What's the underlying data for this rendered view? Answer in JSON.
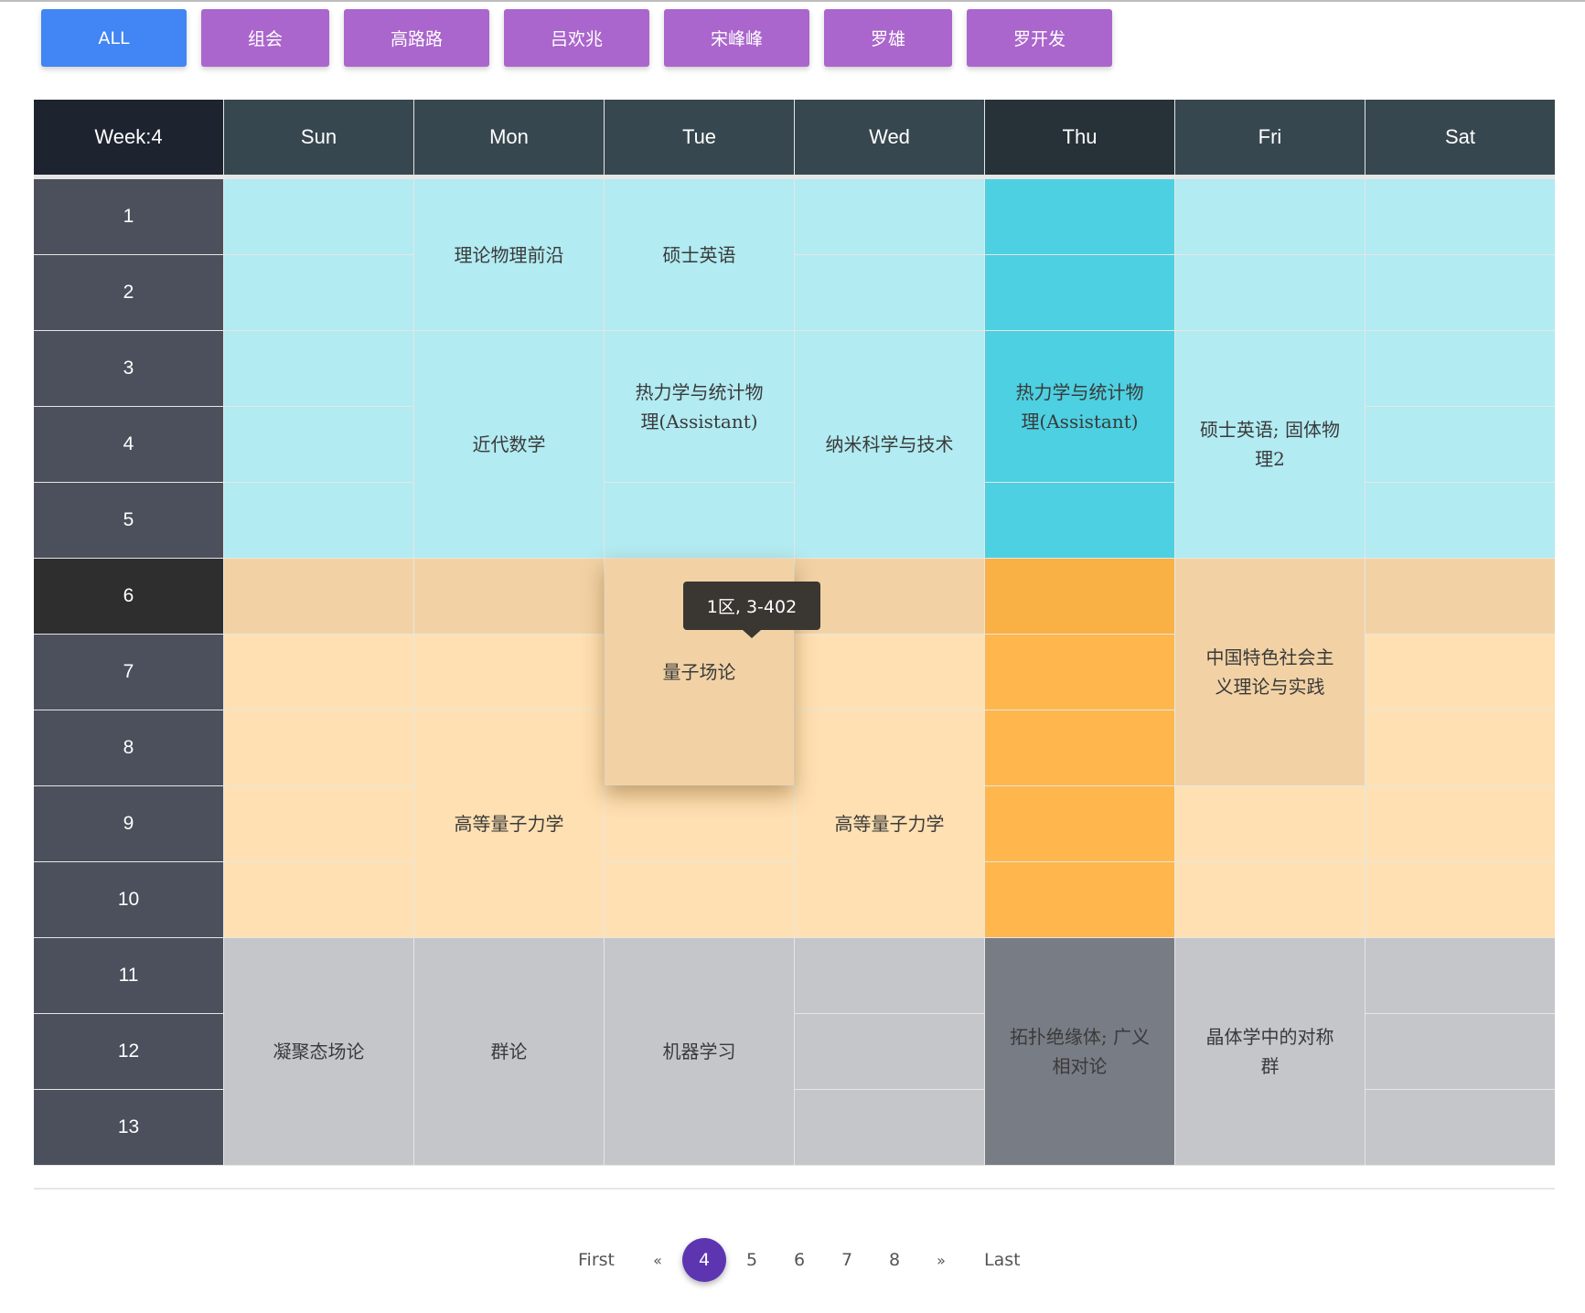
{
  "filters": [
    {
      "label": "ALL",
      "active": true
    },
    {
      "label": "组会",
      "active": false
    },
    {
      "label": "高路路",
      "active": false
    },
    {
      "label": "吕欢兆",
      "active": false
    },
    {
      "label": "宋峰峰",
      "active": false
    },
    {
      "label": "罗雄",
      "active": false
    },
    {
      "label": "罗开发",
      "active": false
    }
  ],
  "timetable": {
    "week_label": "Week:4",
    "days": [
      "Sun",
      "Mon",
      "Tue",
      "Wed",
      "Thu",
      "Fri",
      "Sat"
    ],
    "today_index": 4,
    "periods": [
      "1",
      "2",
      "3",
      "4",
      "5",
      "6",
      "7",
      "8",
      "9",
      "10",
      "11",
      "12",
      "13"
    ],
    "current_period": 6,
    "sections": [
      {
        "name": "morning",
        "from": 1,
        "to": 5
      },
      {
        "name": "afternoon",
        "from": 6,
        "to": 10
      },
      {
        "name": "evening",
        "from": 11,
        "to": 13
      }
    ],
    "colors": {
      "morning": "#b2ebf2",
      "morning_today": "#4dd0e1",
      "afternoon": "#ffe0b2",
      "afternoon_today": "#ffb74d",
      "current_period": "#f2d2a5",
      "current_period_today": "#f9b044",
      "evening": "#c5c6ca",
      "evening_today": "#787c85",
      "header": "#37474f",
      "header_today": "#263238",
      "week_header": "#1e2330",
      "period_header": "#4b505c",
      "period_header_current": "#2e2e2e"
    },
    "courses": [
      {
        "day": 0,
        "start": 11,
        "end": 13,
        "name": "凝聚态场论"
      },
      {
        "day": 1,
        "start": 1,
        "end": 2,
        "name": "理论物理前沿"
      },
      {
        "day": 1,
        "start": 3,
        "end": 5,
        "name": "近代数学"
      },
      {
        "day": 1,
        "start": 8,
        "end": 10,
        "name": "高等量子力学"
      },
      {
        "day": 1,
        "start": 11,
        "end": 13,
        "name": "群论"
      },
      {
        "day": 2,
        "start": 1,
        "end": 2,
        "name": "硕士英语"
      },
      {
        "day": 2,
        "start": 3,
        "end": 4,
        "name": "热力学与统计物理(Assistant)"
      },
      {
        "day": 2,
        "start": 6,
        "end": 8,
        "name": "量子场论",
        "hovered": true,
        "location": "1区, 3-402"
      },
      {
        "day": 2,
        "start": 11,
        "end": 13,
        "name": "机器学习"
      },
      {
        "day": 3,
        "start": 3,
        "end": 5,
        "name": "纳米科学与技术"
      },
      {
        "day": 3,
        "start": 8,
        "end": 10,
        "name": "高等量子力学"
      },
      {
        "day": 4,
        "start": 3,
        "end": 4,
        "name": "热力学与统计物理(Assistant)"
      },
      {
        "day": 4,
        "start": 11,
        "end": 13,
        "name": "拓扑绝缘体; 广义相对论"
      },
      {
        "day": 5,
        "start": 3,
        "end": 5,
        "name": "硕士英语; 固体物理2"
      },
      {
        "day": 5,
        "start": 6,
        "end": 8,
        "name": "中国特色社会主义理论与实践"
      },
      {
        "day": 5,
        "start": 11,
        "end": 13,
        "name": "晶体学中的对称群"
      }
    ]
  },
  "tooltip": {
    "text": "1区, 3-402"
  },
  "pagination": {
    "first_label": "First",
    "prev_label": "«",
    "pages": [
      "4",
      "5",
      "6",
      "7",
      "8"
    ],
    "current_page": "4",
    "next_label": "»",
    "last_label": "Last"
  }
}
